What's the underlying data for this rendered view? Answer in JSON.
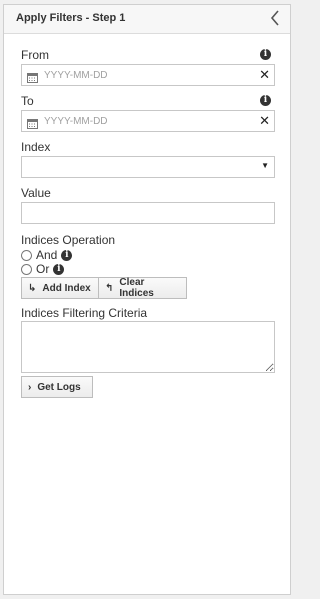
{
  "panel": {
    "title": "Apply Filters - Step 1",
    "collapse_icon": "chevron-left-icon"
  },
  "from": {
    "label": "From",
    "placeholder": "YYYY-MM-DD",
    "value": "",
    "info_icon": "info-icon",
    "calendar_icon": "calendar-icon",
    "clear_icon": "clear-icon"
  },
  "to": {
    "label": "To",
    "placeholder": "YYYY-MM-DD",
    "value": "",
    "info_icon": "info-icon",
    "calendar_icon": "calendar-icon",
    "clear_icon": "clear-icon"
  },
  "index": {
    "label": "Index",
    "selected": ""
  },
  "value": {
    "label": "Value",
    "value": ""
  },
  "indices_operation": {
    "label": "Indices Operation",
    "options": [
      {
        "label": "And",
        "selected": false
      },
      {
        "label": "Or",
        "selected": false
      }
    ]
  },
  "buttons": {
    "add_index": "Add Index",
    "clear_indices": "Clear Indices",
    "get_logs": "Get Logs"
  },
  "criteria": {
    "label": "Indices Filtering Criteria",
    "value": ""
  }
}
